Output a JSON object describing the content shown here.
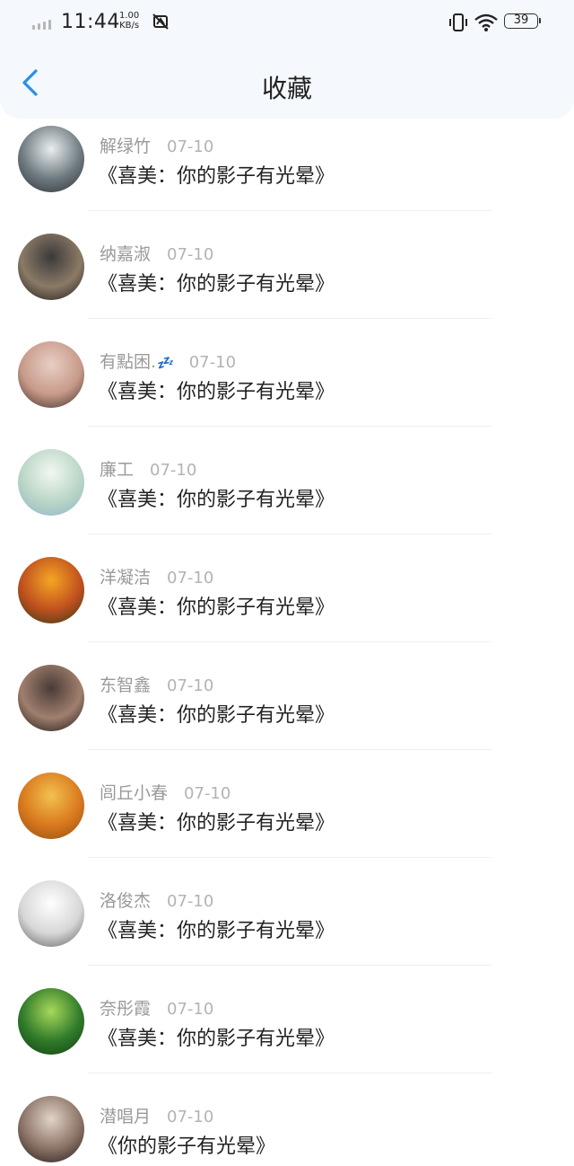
{
  "status_bar": {
    "time": "11:44",
    "net_speed_value": "1.00",
    "net_speed_unit": "KB/s",
    "battery": "39"
  },
  "header": {
    "title": "收藏"
  },
  "items": [
    {
      "name": "解绿竹",
      "badge": "",
      "date": "07-10",
      "content": "《喜美：你的影子有光晕》",
      "avatar_colors": [
        "#e9eef0",
        "#6e7a80",
        "#2b2f33"
      ]
    },
    {
      "name": "纳嘉淑",
      "badge": "",
      "date": "07-10",
      "content": "《喜美：你的影子有光晕》",
      "avatar_colors": [
        "#3a3a3a",
        "#8b7a66",
        "#1a1a1a"
      ]
    },
    {
      "name": "有點困.",
      "badge": "💤",
      "date": "07-10",
      "content": "《喜美：你的影子有光晕》",
      "avatar_colors": [
        "#e8cfc4",
        "#c79a8a",
        "#3b2a26"
      ]
    },
    {
      "name": "廉工",
      "badge": "",
      "date": "07-10",
      "content": "《喜美：你的影子有光晕》",
      "avatar_colors": [
        "#f3f7f1",
        "#b9d6c6",
        "#8fb3c9"
      ]
    },
    {
      "name": "洋凝洁",
      "badge": "",
      "date": "07-10",
      "content": "《喜美：你的影子有光晕》",
      "avatar_colors": [
        "#f5a623",
        "#c0501e",
        "#2c3a1a"
      ]
    },
    {
      "name": "东智鑫",
      "badge": "",
      "date": "07-10",
      "content": "《喜美：你的影子有光晕》",
      "avatar_colors": [
        "#4a3b36",
        "#a07f6e",
        "#191414"
      ]
    },
    {
      "name": "闾丘小春",
      "badge": "",
      "date": "07-10",
      "content": "《喜美：你的影子有光晕》",
      "avatar_colors": [
        "#f2c14e",
        "#d9781e",
        "#8a4f12"
      ]
    },
    {
      "name": "洛俊杰",
      "badge": "",
      "date": "07-10",
      "content": "《喜美：你的影子有光晕》",
      "avatar_colors": [
        "#ffffff",
        "#d7d7d7",
        "#5c5c5c"
      ]
    },
    {
      "name": "奈彤霞",
      "badge": "",
      "date": "07-10",
      "content": "《喜美：你的影子有光晕》",
      "avatar_colors": [
        "#a7d85a",
        "#2f7a2a",
        "#123d12"
      ]
    },
    {
      "name": "潜唱月",
      "badge": "",
      "date": "07-10",
      "content": "《你的影子有光晕》",
      "avatar_colors": [
        "#e2d3c8",
        "#8b7266",
        "#1f1a18"
      ]
    }
  ],
  "colors": {
    "accent": "#2b8fe6",
    "name_text": "#9a9a9a",
    "date_text": "#b3b3b3",
    "content_text": "#222222",
    "header_bg": "#f5f8fc"
  }
}
